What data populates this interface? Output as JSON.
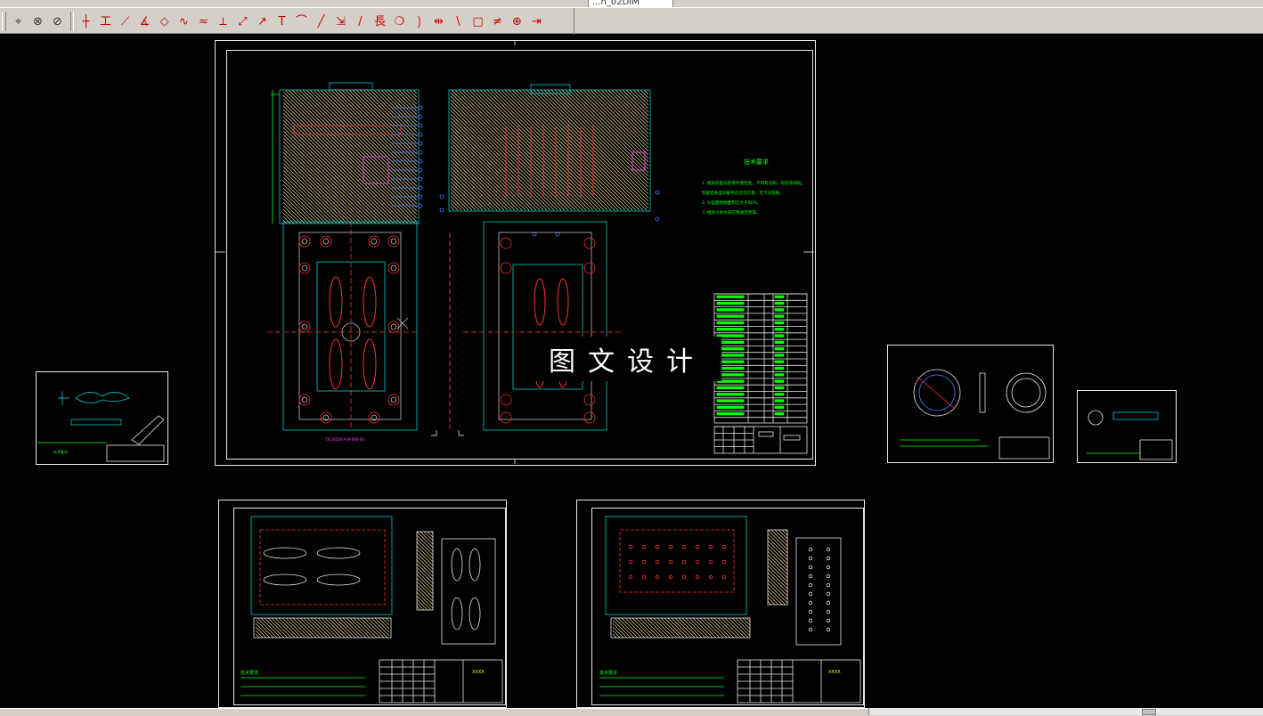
{
  "app": {
    "tab_label": "...n_02DIM"
  },
  "toolbar_icons": [
    "snap-icon",
    "osnap-icon",
    "measure-icon",
    "line-icon",
    "horizontal-dim-icon",
    "aligned-dim-icon",
    "angular-dim-icon",
    "hatch-icon",
    "curve-icon",
    "offset-icon",
    "break-icon",
    "mirror-icon",
    "leader-icon",
    "text-icon",
    "arc-dim-icon",
    "slash-icon",
    "stretch-icon",
    "redline-icon",
    "length-icon",
    "balloon-icon",
    "curve-paren-icon",
    "dim-break-icon",
    "trim-icon",
    "rect-icon",
    "parallel-icon",
    "center-icon",
    "extend-icon"
  ],
  "colors": {
    "background": "#000000",
    "frame": "#e8e8e8",
    "geometry_cyan": "#00c8c8",
    "geometry_green": "#00ff00",
    "geometry_red": "#ff3030",
    "geometry_yellow": "#ffff00",
    "geometry_magenta": "#ff40ff",
    "geometry_blue": "#5080ff",
    "hatch": "#d4c490"
  },
  "watermark": "图文设计",
  "main_sheet": {
    "tech_title": "技术要求",
    "tech_lines": [
      "1. 模具装配前各零件需检查，不得有毛刺、划伤等缺陷。",
      "装配后各运动部件应灵活可靠，无卡滞现象。",
      "2. 分型面接触面积应大于80%。",
      "3. 模具冷却水道应畅通无泄漏。"
    ],
    "bottom_caption": "TX-20200-A09-000-00"
  },
  "small_sheet_left": {
    "note": "技术要求"
  },
  "bottom_left_sheet": {
    "notes_title": "技术要求",
    "title_code": "XXXX"
  },
  "bottom_right_sheet": {
    "notes_title": "技术要求",
    "title_code": "XXXX"
  }
}
